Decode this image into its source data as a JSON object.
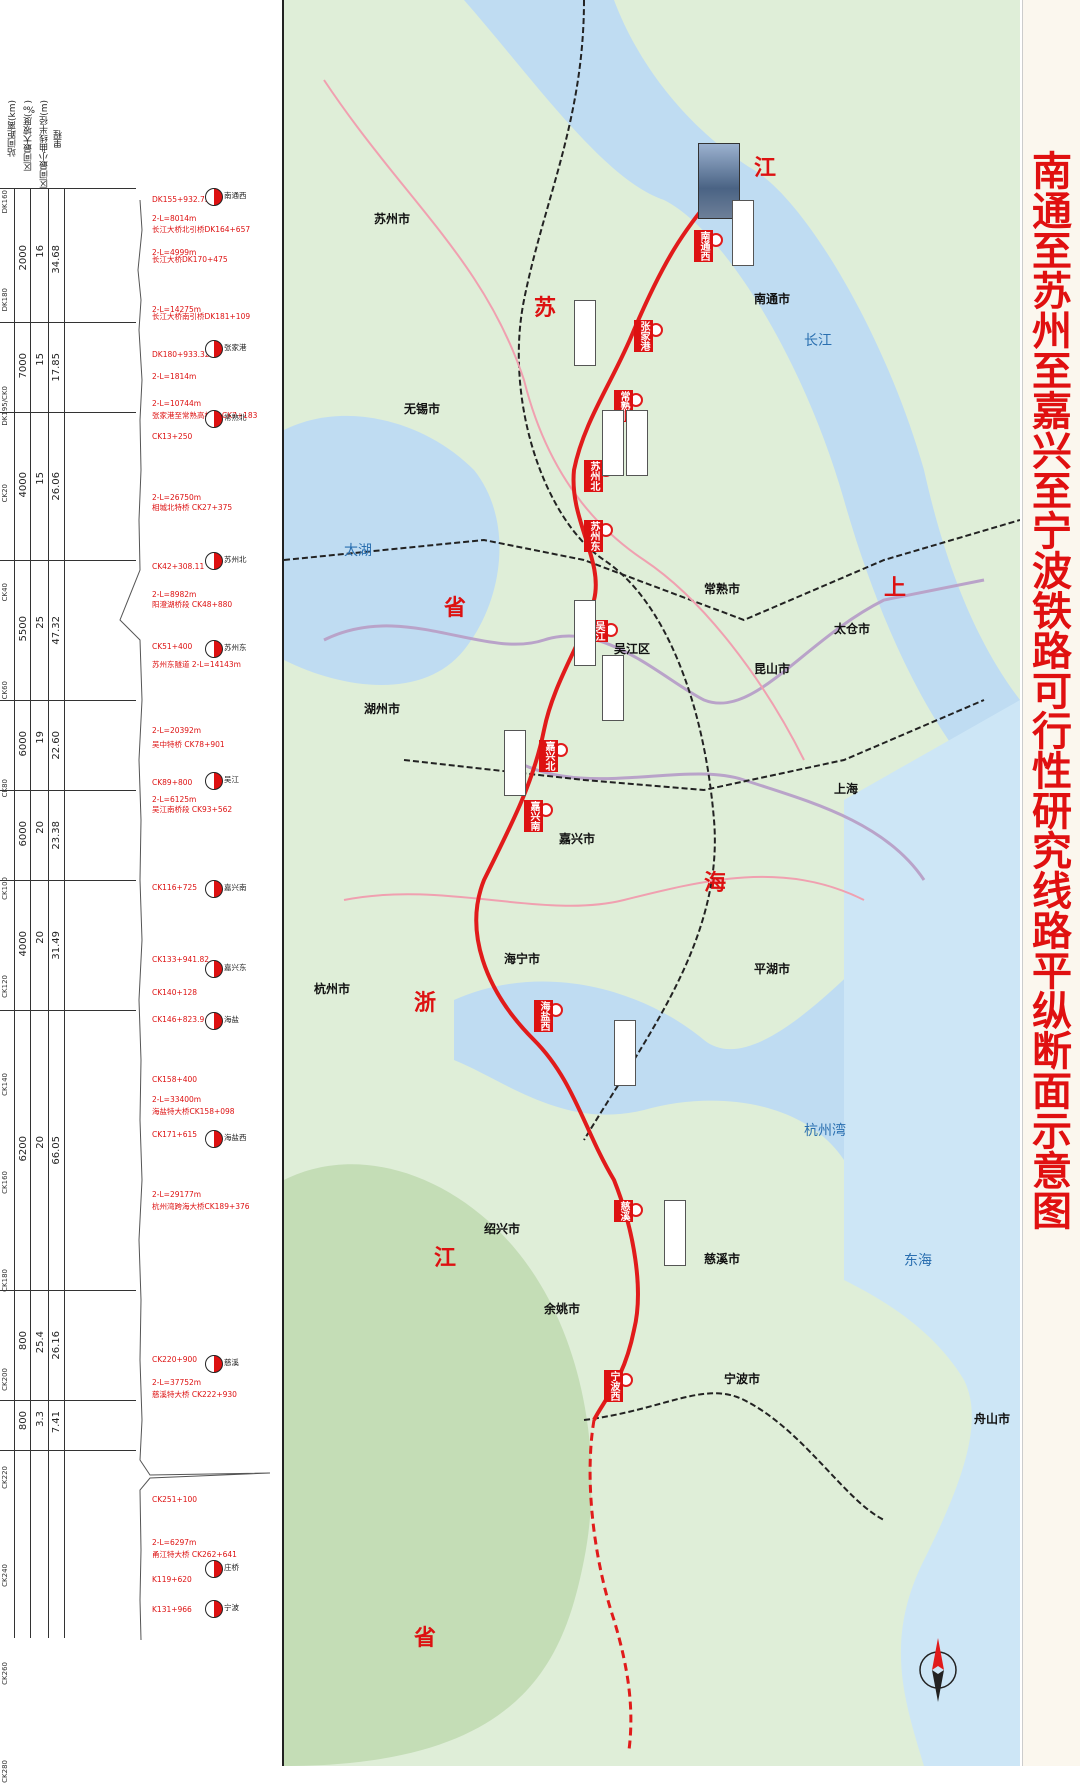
{
  "title": "南通至苏州至嘉兴至宁波铁路可行性研究线路平纵断面示意图",
  "profile": {
    "headers": [
      "站间距离(km)",
      "区间最大坡度(‰)",
      "区间最小曲线半径(m)",
      "里程"
    ],
    "mileages": [
      "DK160",
      "DK180",
      "DK195/CK0",
      "CK20",
      "CK40",
      "CK60",
      "CK80",
      "CK100",
      "CK120",
      "CK140",
      "CK160",
      "CK180",
      "CK200",
      "CK220",
      "CK240",
      "CK260",
      "CK280"
    ],
    "segments": [
      {
        "radius": "2000",
        "grade": "16",
        "distance": "34.68"
      },
      {
        "radius": "7000",
        "grade": "15",
        "distance": "17.85"
      },
      {
        "radius": "4000",
        "grade": "15",
        "distance": "26.06"
      },
      {
        "radius": "5500",
        "grade": "25",
        "distance": "47.32"
      },
      {
        "radius": "6000",
        "grade": "19",
        "distance": "22.60"
      },
      {
        "radius": "6000",
        "grade": "20",
        "distance": "23.38"
      },
      {
        "radius": "4000",
        "grade": "20",
        "distance": "31.49"
      },
      {
        "radius": "6200",
        "grade": "20",
        "distance": "66.05"
      },
      {
        "radius": "800",
        "grade": "25.4",
        "distance": "26.16"
      },
      {
        "radius": "800",
        "grade": "3.3",
        "distance": "7.41"
      }
    ],
    "notes": [
      "DK155+932.735",
      "2-L=8014m",
      "长江大桥北引桥DK164+657",
      "2-L=4999m",
      "长江大桥DK170+475",
      "2-L=14275m",
      "长江大桥南引桥DK181+109",
      "DK180+933.32",
      "2-L=1814m",
      "2-L=10744m",
      "张家港至常熟高桥段 CK7+183",
      "CK13+250",
      "2-L=26750m",
      "相城北特桥 CK27+375",
      "CK42+308.11",
      "2-L=8982m",
      "阳澄湖桥段 CK48+880",
      "CK51+400",
      "苏州东隧道 2-L=14143m",
      "2-L=20392m",
      "吴中特桥 CK78+901",
      "CK89+800",
      "2-L=6125m",
      "吴江南桥段 CK93+562",
      "CK116+725",
      "CK133+941.82",
      "CK140+128",
      "CK146+823.9",
      "CK158+400",
      "2-L=33400m",
      "海盐特大桥CK158+098",
      "CK171+615",
      "2-L=29177m",
      "杭州湾跨海大桥CK189+376",
      "CK220+900",
      "2-L=37752m",
      "慈溪特大桥 CK222+930",
      "CK251+100",
      "2-L=6297m",
      "甬江特大桥 CK262+641",
      "K119+620",
      "K131+966"
    ],
    "stations": [
      "南通西",
      "张家港",
      "常熟北",
      "苏州北",
      "苏州东",
      "吴江",
      "嘉兴南",
      "嘉兴东",
      "海盐",
      "海盐西",
      "慈溪",
      "庄桥",
      "宁波"
    ]
  },
  "map": {
    "provinces": [
      "江",
      "苏",
      "省",
      "上",
      "海",
      "浙",
      "江",
      "省"
    ],
    "cities": [
      "苏州市",
      "无锡市",
      "南通市",
      "上海",
      "嘉兴市",
      "宁波市",
      "湖州市",
      "杭州市",
      "绍兴市",
      "舟山市",
      "太仓市",
      "常熟市",
      "昆山市",
      "吴江区",
      "海宁市",
      "平湖市",
      "慈溪市",
      "余姚市"
    ],
    "stations": [
      "南通西",
      "张家港",
      "常熟北",
      "苏州北",
      "苏州东",
      "吴江",
      "嘉兴北",
      "嘉兴南",
      "海盐西",
      "慈溪",
      "宁波西"
    ],
    "features": [
      "长江",
      "太湖",
      "杭州湾",
      "东海"
    ],
    "colors": {
      "route": "#e11b1b",
      "rail": "#222222",
      "water": "#bfdcf2",
      "land": "#dfeed8",
      "title": "#e01010"
    }
  }
}
